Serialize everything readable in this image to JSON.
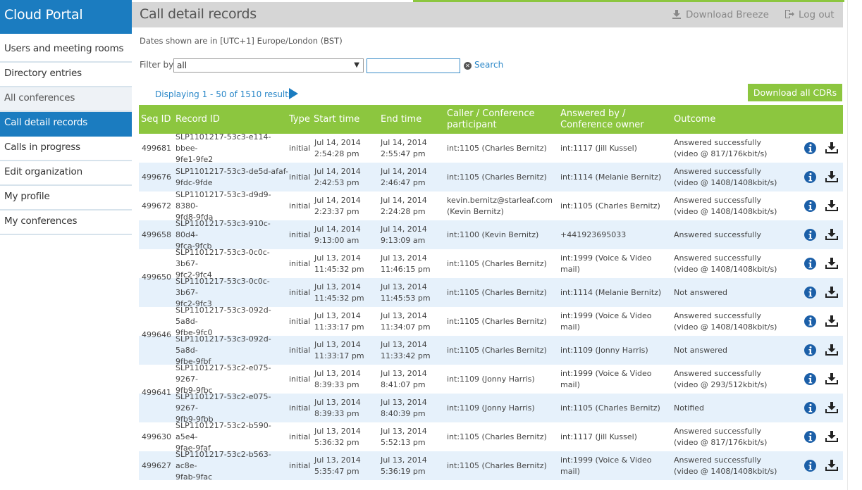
{
  "sidebar": {
    "brand": "Cloud Portal",
    "items": [
      {
        "label": "Users and meeting rooms"
      },
      {
        "label": "Directory entries"
      },
      {
        "label": "All conferences"
      },
      {
        "label": "Call detail records"
      },
      {
        "label": "Calls in progress"
      },
      {
        "label": "Edit organization"
      },
      {
        "label": "My profile"
      },
      {
        "label": "My conferences"
      }
    ]
  },
  "header": {
    "title": "Call detail records",
    "download_breeze": "Download Breeze",
    "logout": "Log out"
  },
  "main": {
    "timezone_note": "Dates shown are in [UTC+1] Europe/London (BST)",
    "filter_label": "Filter by",
    "filter_value": "all",
    "search_value": "",
    "search_label": "Search",
    "displaying": "Displaying 1 - 50 of 1510 results",
    "download_all": "Download all CDRs"
  },
  "table": {
    "columns": [
      "Seq ID",
      "Record ID",
      "Type",
      "Start time",
      "End time",
      "Caller / Conference participant",
      "Answered by / Conference owner",
      "Outcome"
    ],
    "rows": [
      {
        "seq": "499681",
        "rid1": "SLP1101217-53c3-e114-bbee-",
        "rid2": "9fe1-9fe2",
        "type": "initial",
        "s1": "Jul 14, 2014",
        "s2": "2:54:28 pm",
        "e1": "Jul 14, 2014",
        "e2": "2:55:47 pm",
        "c1": "int:1105 (Charles Bernitz)",
        "c2": "",
        "a1": "int:1117 (Jill Kussel)",
        "o1": "Answered successfully",
        "o2": "(video @ 817/176kbit/s)"
      },
      {
        "seq": "499676",
        "rid1": "SLP1101217-53c3-de5d-afaf-",
        "rid2": "9fdc-9fde",
        "type": "initial",
        "s1": "Jul 14, 2014",
        "s2": "2:42:53 pm",
        "e1": "Jul 14, 2014",
        "e2": "2:46:47 pm",
        "c1": "int:1105 (Charles Bernitz)",
        "c2": "",
        "a1": "int:1114 (Melanie Bernitz)",
        "o1": "Answered successfully",
        "o2": "(video @ 1408/1408kbit/s)"
      },
      {
        "seq": "499672",
        "rid1": "SLP1101217-53c3-d9d9-8380-",
        "rid2": "9fd8-9fda",
        "type": "initial",
        "s1": "Jul 14, 2014",
        "s2": "2:23:37 pm",
        "e1": "Jul 14, 2014",
        "e2": "2:24:28 pm",
        "c1": "kevin.bernitz@starleaf.com",
        "c2": "(Kevin Bernitz)",
        "a1": "int:1105 (Charles Bernitz)",
        "o1": "Answered successfully",
        "o2": "(video @ 1408/1408kbit/s)"
      },
      {
        "seq": "499658",
        "rid1": "SLP1101217-53c3-910c-80d4-",
        "rid2": "9fca-9fcb",
        "type": "initial",
        "s1": "Jul 14, 2014",
        "s2": "9:13:00 am",
        "e1": "Jul 14, 2014",
        "e2": "9:13:09 am",
        "c1": "int:1100 (Kevin Bernitz)",
        "c2": "",
        "a1": "+441923695033",
        "o1": "Answered successfully",
        "o2": ""
      },
      {
        "seq": "",
        "rid1": "SLP1101217-53c3-0c0c-3b67-",
        "rid2": "9fc2-9fc4",
        "type": "initial",
        "s1": "Jul 13, 2014",
        "s2": "11:45:32 pm",
        "e1": "Jul 13, 2014",
        "e2": "11:46:15 pm",
        "c1": "int:1105 (Charles Bernitz)",
        "c2": "",
        "a1": "int:1999 (Voice & Video mail)",
        "o1": "Answered successfully",
        "o2": "(video @ 1408/1408kbit/s)"
      },
      {
        "seq": "",
        "rid1": "SLP1101217-53c3-0c0c-3b67-",
        "rid2": "9fc2-9fc3",
        "type": "initial",
        "s1": "Jul 13, 2014",
        "s2": "11:45:32 pm",
        "e1": "Jul 13, 2014",
        "e2": "11:45:53 pm",
        "c1": "int:1105 (Charles Bernitz)",
        "c2": "",
        "a1": "int:1114 (Melanie Bernitz)",
        "o1": "Not answered",
        "o2": ""
      },
      {
        "seq": "",
        "rid1": "SLP1101217-53c3-092d-5a8d-",
        "rid2": "9fbe-9fc0",
        "type": "initial",
        "s1": "Jul 13, 2014",
        "s2": "11:33:17 pm",
        "e1": "Jul 13, 2014",
        "e2": "11:34:07 pm",
        "c1": "int:1105 (Charles Bernitz)",
        "c2": "",
        "a1": "int:1999 (Voice & Video mail)",
        "o1": "Answered successfully",
        "o2": "(video @ 1408/1408kbit/s)"
      },
      {
        "seq": "",
        "rid1": "SLP1101217-53c3-092d-5a8d-",
        "rid2": "9fbe-9fbf",
        "type": "initial",
        "s1": "Jul 13, 2014",
        "s2": "11:33:17 pm",
        "e1": "Jul 13, 2014",
        "e2": "11:33:42 pm",
        "c1": "int:1105 (Charles Bernitz)",
        "c2": "",
        "a1": "int:1109 (Jonny Harris)",
        "o1": "Not answered",
        "o2": ""
      },
      {
        "seq": "",
        "rid1": "SLP1101217-53c2-e075-9267-",
        "rid2": "9fb9-9fbc",
        "type": "initial",
        "s1": "Jul 13, 2014",
        "s2": "8:39:33 pm",
        "e1": "Jul 13, 2014",
        "e2": "8:41:07 pm",
        "c1": "int:1109 (Jonny Harris)",
        "c2": "",
        "a1": "int:1999 (Voice & Video mail)",
        "o1": "Answered successfully",
        "o2": "(video @ 293/512kbit/s)"
      },
      {
        "seq": "",
        "rid1": "SLP1101217-53c2-e075-9267-",
        "rid2": "9fb9-9fbb",
        "type": "initial",
        "s1": "Jul 13, 2014",
        "s2": "8:39:33 pm",
        "e1": "Jul 13, 2014",
        "e2": "8:40:39 pm",
        "c1": "int:1109 (Jonny Harris)",
        "c2": "",
        "a1": "int:1105 (Charles Bernitz)",
        "o1": "Notified",
        "o2": ""
      },
      {
        "seq": "499630",
        "rid1": "SLP1101217-53c2-b590-a5e4-",
        "rid2": "9fae-9faf",
        "type": "initial",
        "s1": "Jul 13, 2014",
        "s2": "5:36:32 pm",
        "e1": "Jul 13, 2014",
        "e2": "5:52:13 pm",
        "c1": "int:1105 (Charles Bernitz)",
        "c2": "",
        "a1": "int:1117 (Jill Kussel)",
        "o1": "Answered successfully",
        "o2": "(video @ 817/176kbit/s)"
      },
      {
        "seq": "499627",
        "rid1": "SLP1101217-53c2-b563-ac8e-",
        "rid2": "9fab-9fac",
        "type": "initial",
        "s1": "Jul 13, 2014",
        "s2": "5:35:47 pm",
        "e1": "Jul 13, 2014",
        "e2": "5:36:19 pm",
        "c1": "int:1105 (Charles Bernitz)",
        "c2": "",
        "a1": "int:1999 (Voice & Video mail)",
        "o1": "Answered successfully",
        "o2": "(video @ 1408/1408kbit/s)"
      }
    ],
    "group_seq": [
      "499650",
      "499646",
      "499641"
    ]
  },
  "colors": {
    "brand": "#1b7cc0",
    "accent_green": "#8cc63f",
    "row_alt": "#e6f1fb",
    "header_bar": "#d6d6d6"
  },
  "icons": {
    "info": "info-icon",
    "download": "download-icon"
  }
}
